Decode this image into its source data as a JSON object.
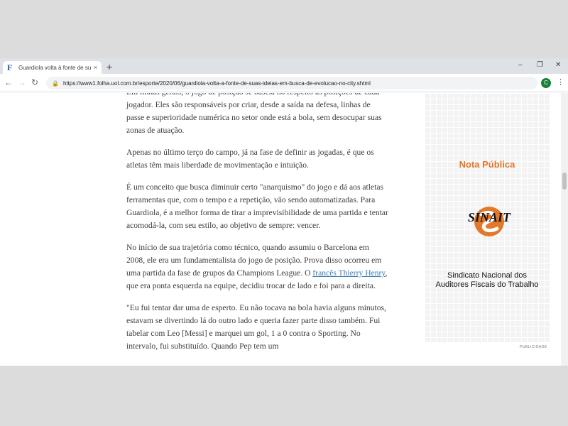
{
  "tab": {
    "favicon": "F",
    "title": "Guardiola volta à fonte de suas id...",
    "close": "×"
  },
  "newtab": "+",
  "window": {
    "minimize": "–",
    "restore": "❐",
    "close": "✕"
  },
  "toolbar": {
    "back": "←",
    "forward": "→",
    "reload": "↻",
    "lock": "🔒",
    "url": "https://www1.folha.uol.com.br/esporte/2020/06/guardiola-volta-a-fonte-de-suas-ideias-em-busca-de-evolucao-no-city.shtml",
    "profile": "C",
    "menu": "⋮"
  },
  "article": {
    "p1": "Em linhas gerais, o jogo de posição se baseia no respeito às posições de cada jogador. Eles são responsáveis por criar, desde a saída na defesa, linhas de passe e superioridade numérica no setor onde está a bola, sem desocupar suas zonas de atuação.",
    "p2": "Apenas no último terço do campo, já na fase de definir as jogadas, é que os atletas têm mais liberdade de movimentação e intuição.",
    "p3": "É um conceito que busca diminuir certo \"anarquismo\" do jogo e dá aos atletas ferramentas que, com o tempo e a repetição, vão sendo automatizadas. Para Guardiola, é a melhor forma de tirar a imprevisibilidade de uma partida e tentar acomodá-la, com seu estilo, ao objetivo de sempre: vencer.",
    "p4_before": "No início de sua trajetória como técnico, quando assumiu o Barcelona em 2008, ele era um fundamentalista do jogo de posição. Prova disso ocorreu em uma partida da fase de grupos da Champions League. O ",
    "p4_link": "francês Thierry Henry",
    "p4_after": ", que era ponta esquerda na equipe, decidiu trocar de lado e foi para a direita.",
    "p5": "\"Eu fui tentar dar uma de esperto. Eu não tocava na bola havia alguns minutos, estavam se divertindo lá do outro lado e queria fazer parte disso também. Fui tabelar com Leo [Messi] e marquei um gol, 1 a 0 contra o Sporting. No intervalo, fui substituído. Quando Pep tem um"
  },
  "ad": {
    "title": "Nota Pública",
    "logo_text": "SINAIT",
    "line1": "Sindicato Nacional dos",
    "line2": "Auditores Fiscais do Trabalho",
    "label": "PUBLICIDADE"
  },
  "colors": {
    "ad_title": "#e3782a",
    "link": "#3a7bb2",
    "logo_orange": "#e3782a"
  }
}
